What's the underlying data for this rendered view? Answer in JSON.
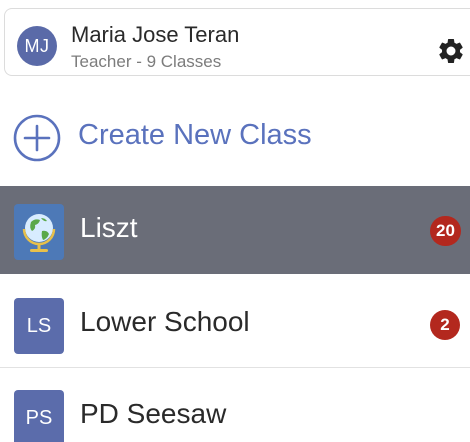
{
  "profile": {
    "initials": "MJ",
    "name": "Maria Jose Teran",
    "subtitle": "Teacher - 9 Classes",
    "settings_icon": "gear-icon"
  },
  "create_class": {
    "label": "Create New Class",
    "icon": "plus-circle-icon"
  },
  "classes": [
    {
      "name": "Liszt",
      "tile": "globe-icon",
      "badge": "20",
      "selected": true
    },
    {
      "name": "Lower School",
      "tile": "LS",
      "badge": "2",
      "selected": false
    },
    {
      "name": "PD Seesaw",
      "tile": "PS",
      "badge": "",
      "selected": false
    }
  ],
  "colors": {
    "accent": "#5a72bd",
    "avatar": "#5a6aa8",
    "selected_row": "#6a6d78",
    "badge": "#b3281e"
  }
}
